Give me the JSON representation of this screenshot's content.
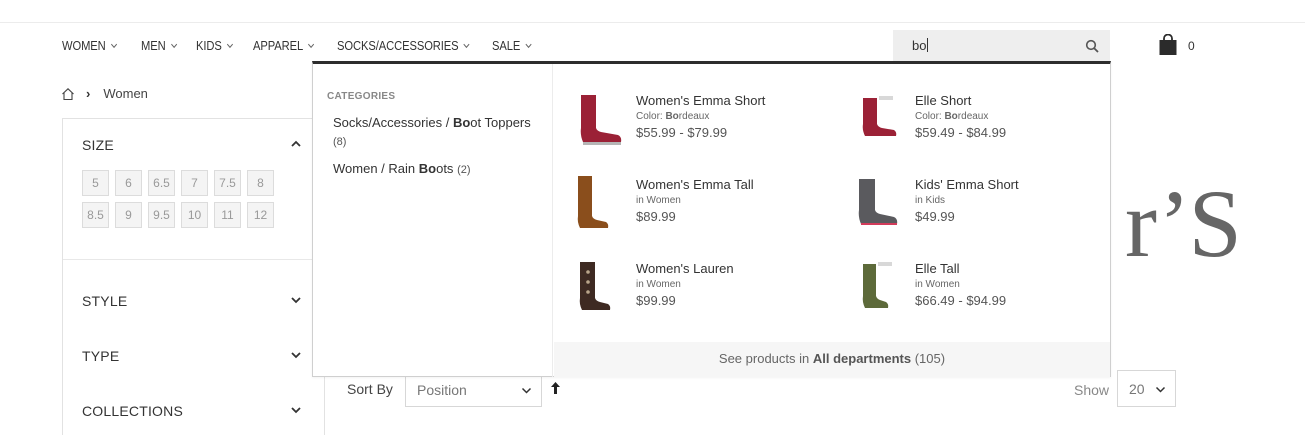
{
  "nav": {
    "items": [
      "WOMEN",
      "MEN",
      "KIDS",
      "APPAREL",
      "SOCKS/ACCESSORIES",
      "SALE"
    ]
  },
  "search": {
    "value": "bo"
  },
  "cart": {
    "count": "0"
  },
  "breadcrumb": {
    "current": "Women"
  },
  "filters": {
    "size_title": "SIZE",
    "sizes": [
      "5",
      "6",
      "6.5",
      "7",
      "7.5",
      "8",
      "8.5",
      "9",
      "9.5",
      "10",
      "11",
      "12"
    ],
    "style_title": "STYLE",
    "type_title": "TYPE",
    "collections_title": "COLLECTIONS"
  },
  "logo_fragment": "r’S",
  "sort": {
    "label": "Sort By",
    "value": "Position"
  },
  "show": {
    "label": "Show",
    "value": "20"
  },
  "dropdown": {
    "categories_heading": "CATEGORIES",
    "categories": [
      {
        "pre": "Socks/Accessories / ",
        "bold": "Bo",
        "post": "ot Toppers",
        "count": "(8)"
      },
      {
        "pre": "Women / Rain ",
        "bold": "Bo",
        "post": "ots",
        "count": "(2)"
      }
    ],
    "products": [
      {
        "name": "Women's Emma Short",
        "sub_pre": "Color: ",
        "sub_bold": "Bo",
        "sub_post": "rdeaux",
        "price": "$55.99 - $79.99",
        "color": "#9b2136"
      },
      {
        "name": "Elle Short",
        "sub_pre": "Color: ",
        "sub_bold": "Bo",
        "sub_post": "rdeaux",
        "price": "$59.49 - $84.99",
        "color": "#9b2136"
      },
      {
        "name": "Women's Emma Tall",
        "sub_pre": "in Women",
        "sub_bold": "",
        "sub_post": "",
        "price": "$89.99",
        "color": "#8a4e1c"
      },
      {
        "name": "Kids' Emma Short",
        "sub_pre": "in Kids",
        "sub_bold": "",
        "sub_post": "",
        "price": "$49.99",
        "color": "#5a5a5e"
      },
      {
        "name": "Women's Lauren",
        "sub_pre": "in Women",
        "sub_bold": "",
        "sub_post": "",
        "price": "$99.99",
        "color": "#3e2a22"
      },
      {
        "name": "Elle Tall",
        "sub_pre": "in Women",
        "sub_bold": "",
        "sub_post": "",
        "price": "$66.49 - $94.99",
        "color": "#5d6a3a"
      }
    ],
    "see_all_pre": "See products in ",
    "see_all_bold": "All departments",
    "see_all_count": " (105)"
  }
}
